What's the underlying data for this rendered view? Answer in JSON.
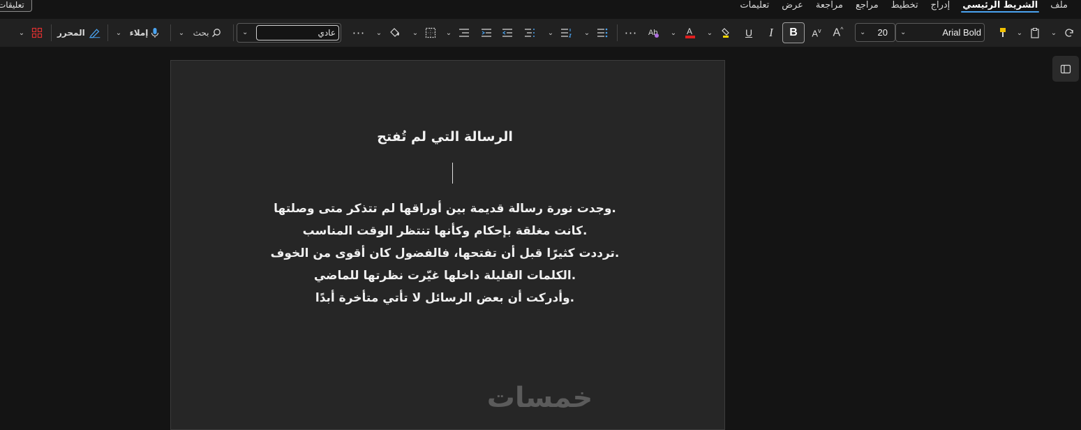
{
  "menu": {
    "tabs": [
      "ملف",
      "الشريط الرئيسي",
      "إدراج",
      "تخطيط",
      "مراجع",
      "مراجعة",
      "عرض",
      "تعليمات"
    ],
    "active_tab": "الشريط الرئيسي",
    "comment_label": "تعليقات"
  },
  "ribbon": {
    "font_name": "Arial Bold",
    "font_size": "20",
    "style_value": "عادي",
    "search_label": "بحث",
    "dictate_label": "إملاء",
    "editor_label": "المحرر",
    "colors": {
      "font_color": "#e02020",
      "highlight": "#f5d400",
      "format_painter": "#f0c000",
      "addins": "#e03030",
      "accent": "#4aa3f0"
    }
  },
  "document": {
    "title": "الرسالة التي لم تُفتح",
    "lines": [
      ".وجدت نورة رسالة قديمة بين أوراقها لم تتذكر متى وصلتها",
      ".كانت مغلقة بإحكام وكأنها تنتظر الوقت المناسب",
      ".ترددت كثيرًا قبل أن تفتحها، فالفضول كان أقوى من الخوف",
      ".الكلمات القليلة داخلها غيّرت نظرتها للماضي",
      ".وأدركت أن بعض الرسائل لا تأتي متأخرة أبدًا"
    ]
  },
  "watermark": "خمسات"
}
